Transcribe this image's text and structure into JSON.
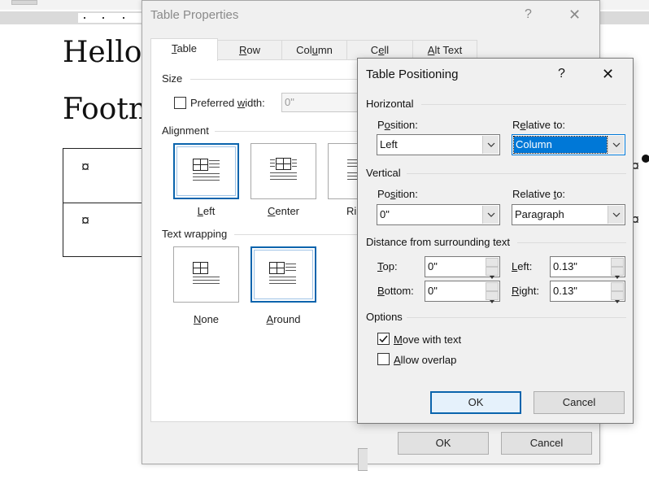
{
  "document": {
    "line1": "Hello·",
    "line2": "Footno",
    "cell_marks": [
      "¤",
      "¤"
    ],
    "right_marks": [
      "¤",
      "¤"
    ]
  },
  "table_properties": {
    "title": "Table Properties",
    "help": "?",
    "close": "✕",
    "tabs": [
      {
        "label": "Table",
        "active": true
      },
      {
        "label": "Row"
      },
      {
        "label": "Column"
      },
      {
        "label": "Cell"
      },
      {
        "label": "Alt Text"
      }
    ],
    "size": {
      "section": "Size",
      "preferred_width_label": "Preferred width:",
      "preferred_width_value": "0\"",
      "checked": false
    },
    "alignment": {
      "section": "Alignment",
      "options": [
        {
          "label": "Left",
          "selected": true
        },
        {
          "label": "Center"
        },
        {
          "label": "Ri"
        }
      ]
    },
    "text_wrapping": {
      "section": "Text wrapping",
      "options": [
        {
          "label": "None"
        },
        {
          "label": "Around",
          "selected": true
        }
      ]
    },
    "ok": "OK",
    "cancel": "Cancel"
  },
  "table_positioning": {
    "title": "Table Positioning",
    "help": "?",
    "close": "✕",
    "horizontal": {
      "section": "Horizontal",
      "position_label": "Position:",
      "position_value": "Left",
      "relative_label": "Relative to:",
      "relative_value": "Column"
    },
    "vertical": {
      "section": "Vertical",
      "position_label": "Position:",
      "position_value": "0\"",
      "relative_label": "Relative to:",
      "relative_value": "Paragraph"
    },
    "distance": {
      "section": "Distance from surrounding text",
      "top_label": "Top:",
      "top_value": "0\"",
      "bottom_label": "Bottom:",
      "bottom_value": "0\"",
      "left_label": "Left:",
      "left_value": "0.13\"",
      "right_label": "Right:",
      "right_value": "0.13\""
    },
    "options": {
      "section": "Options",
      "move_with_text": "Move with text",
      "move_with_text_checked": true,
      "allow_overlap": "Allow overlap",
      "allow_overlap_checked": false
    },
    "ok": "OK",
    "cancel": "Cancel"
  }
}
